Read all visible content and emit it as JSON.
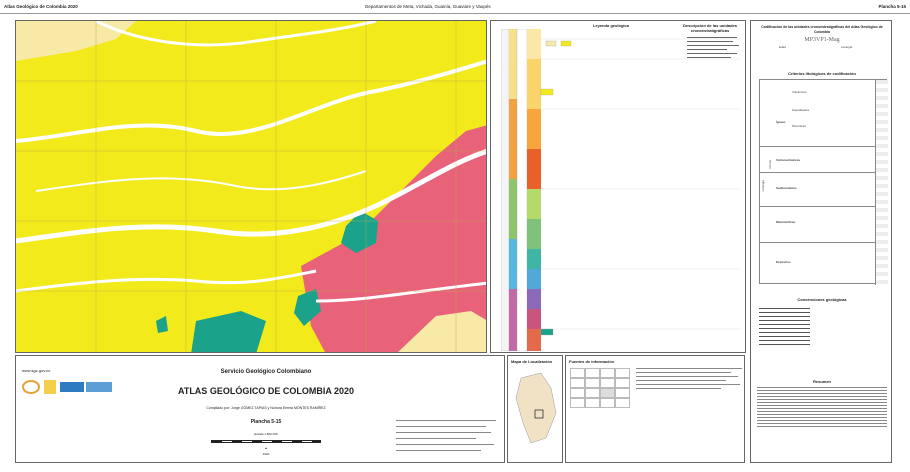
{
  "header": {
    "left": "Atlas Geológico de Colombia 2020",
    "center": "Departamentos de Meta, Vichada, Guainía, Guaviare y Vaupés",
    "right": "Plancha 5-15"
  },
  "colors": {
    "yellow": "#f3ea1b",
    "pink": "#e8627a",
    "green": "#1aa38a",
    "cream": "#f6eaa6",
    "river": "#ffffff"
  },
  "legend": {
    "title": "Leyenda geológica",
    "description_title": "Descripción de las unidades cronoestratigráficas"
  },
  "title_block": {
    "website": "www.sgc.gov.co",
    "institution": "Servicio Geológico Colombiano",
    "atlas_title": "ATLAS GEOLÓGICO DE COLOMBIA 2020",
    "compiled_by": "Compilado por: Jorge GÓMEZ TAPIAS y Nohora Emma MONTES RAMÍREZ",
    "plate": "Plancha 5-15",
    "scale": "Escala 1:500 000",
    "year": "2020",
    "logos": [
      "SERVICIO GEOLÓGICO COLOMBIANO",
      "El futuro es de todos",
      "Minenergía"
    ]
  },
  "location_map": {
    "title": "Mapa de Localización"
  },
  "sources": {
    "title": "Fuentes de información"
  },
  "classification": {
    "title": "Codificación de las unidades cronoestratigráficas del Atlas Geológico de Colombia",
    "example_code": "MP3VP1-Mag",
    "labels": [
      "Edad",
      "Litología"
    ],
    "criteria_title": "Criterios litológicos de codificación",
    "axis_labels": [
      "Rocas",
      "Litología"
    ],
    "groups": [
      "Ígneas",
      "Volcanoclásticas",
      "Sedimentarias",
      "Metamórficas",
      "Depósitos"
    ],
    "subgroups": [
      "Volcánicas",
      "Hipoabisales",
      "Plutónicas"
    ]
  },
  "conventions": {
    "title": "Convenciones geológicas"
  },
  "summary": {
    "title": "Resumen"
  }
}
